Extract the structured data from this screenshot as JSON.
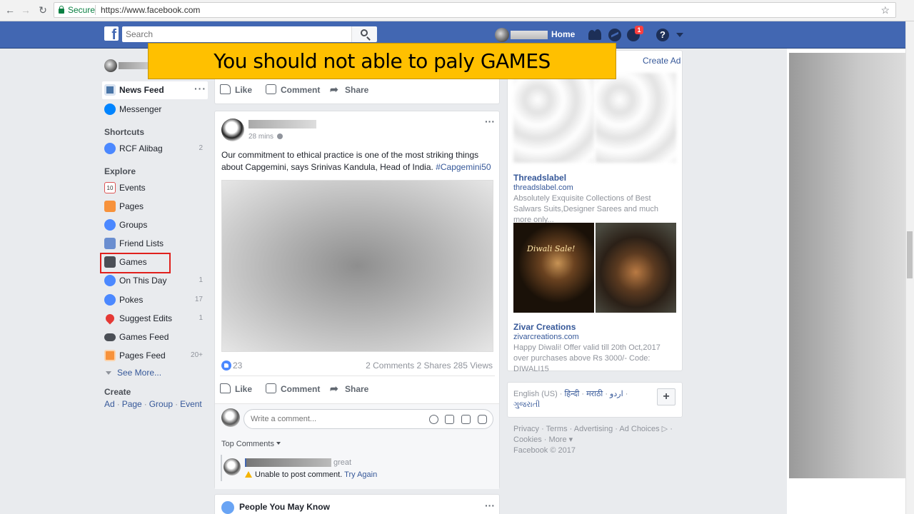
{
  "browser": {
    "secure_label": "Secure",
    "url": "https://www.facebook.com"
  },
  "topbar": {
    "logo": "f",
    "search_placeholder": "Search",
    "home_label": "Home",
    "notification_count": "1",
    "help_label": "?"
  },
  "banner": {
    "text": "You should not able to paly GAMES"
  },
  "sidebar": {
    "news_feed": "News Feed",
    "messenger": "Messenger",
    "shortcuts_title": "Shortcuts",
    "shortcut_item": {
      "label": "RCF Alibag",
      "count": "2"
    },
    "explore_title": "Explore",
    "explore_items": [
      {
        "label": "Events",
        "count": ""
      },
      {
        "label": "Pages",
        "count": ""
      },
      {
        "label": "Groups",
        "count": ""
      },
      {
        "label": "Friend Lists",
        "count": ""
      },
      {
        "label": "Games",
        "count": ""
      },
      {
        "label": "On This Day",
        "count": "1"
      },
      {
        "label": "Pokes",
        "count": "17"
      },
      {
        "label": "Suggest Edits",
        "count": "1"
      },
      {
        "label": "Games Feed",
        "count": ""
      },
      {
        "label": "Pages Feed",
        "count": "20+"
      }
    ],
    "see_more": "See More...",
    "create_title": "Create",
    "create_links": [
      "Ad",
      "Page",
      "Group",
      "Event"
    ],
    "colors": {
      "highlight_border": "#e0201d"
    }
  },
  "actions": {
    "like": "Like",
    "comment": "Comment",
    "share": "Share"
  },
  "post": {
    "time": "28 mins",
    "text": "Our commitment to ethical practice is one of the most striking things about Capgemini, says Srinivas Kandula, Head of India.",
    "hashtag": "#Capgemini50",
    "reaction_count": "23",
    "comments": "2 Comments",
    "shares": "2 Shares",
    "views": "285 Views",
    "comment_placeholder": "Write a comment...",
    "top_comments_label": "Top Comments",
    "reply_text": "great",
    "error_text": "Unable to post comment.",
    "retry_text": "Try Again"
  },
  "people_you_may_know": "People You May Know",
  "ads": {
    "create_ad": "Create Ad",
    "items": [
      {
        "title": "Threadslabel",
        "url": "threadslabel.com",
        "desc": "Absolutely Exquisite Collections of Best Salwars Suits,Designer Sarees and much more only..."
      },
      {
        "title": "Zivar Creations",
        "url": "zivarcreations.com",
        "desc": "Happy Diwali! Offer valid till 20th Oct,2017 over purchases above Rs 3000/- Code: DIWALI15"
      }
    ],
    "image_caption": "Diwali Sale!"
  },
  "languages": {
    "current": "English (US)",
    "others": [
      "हिन्दी",
      "मराठी",
      "اردو",
      "ગુજરાતી"
    ]
  },
  "footer": {
    "links": [
      "Privacy",
      "Terms",
      "Advertising",
      "Ad Choices",
      "Cookies",
      "More"
    ],
    "copyright": "Facebook © 2017"
  },
  "colors": {
    "facebook_blue": "#4267b2",
    "banner_yellow": "#ffc000",
    "link_blue": "#365899"
  }
}
